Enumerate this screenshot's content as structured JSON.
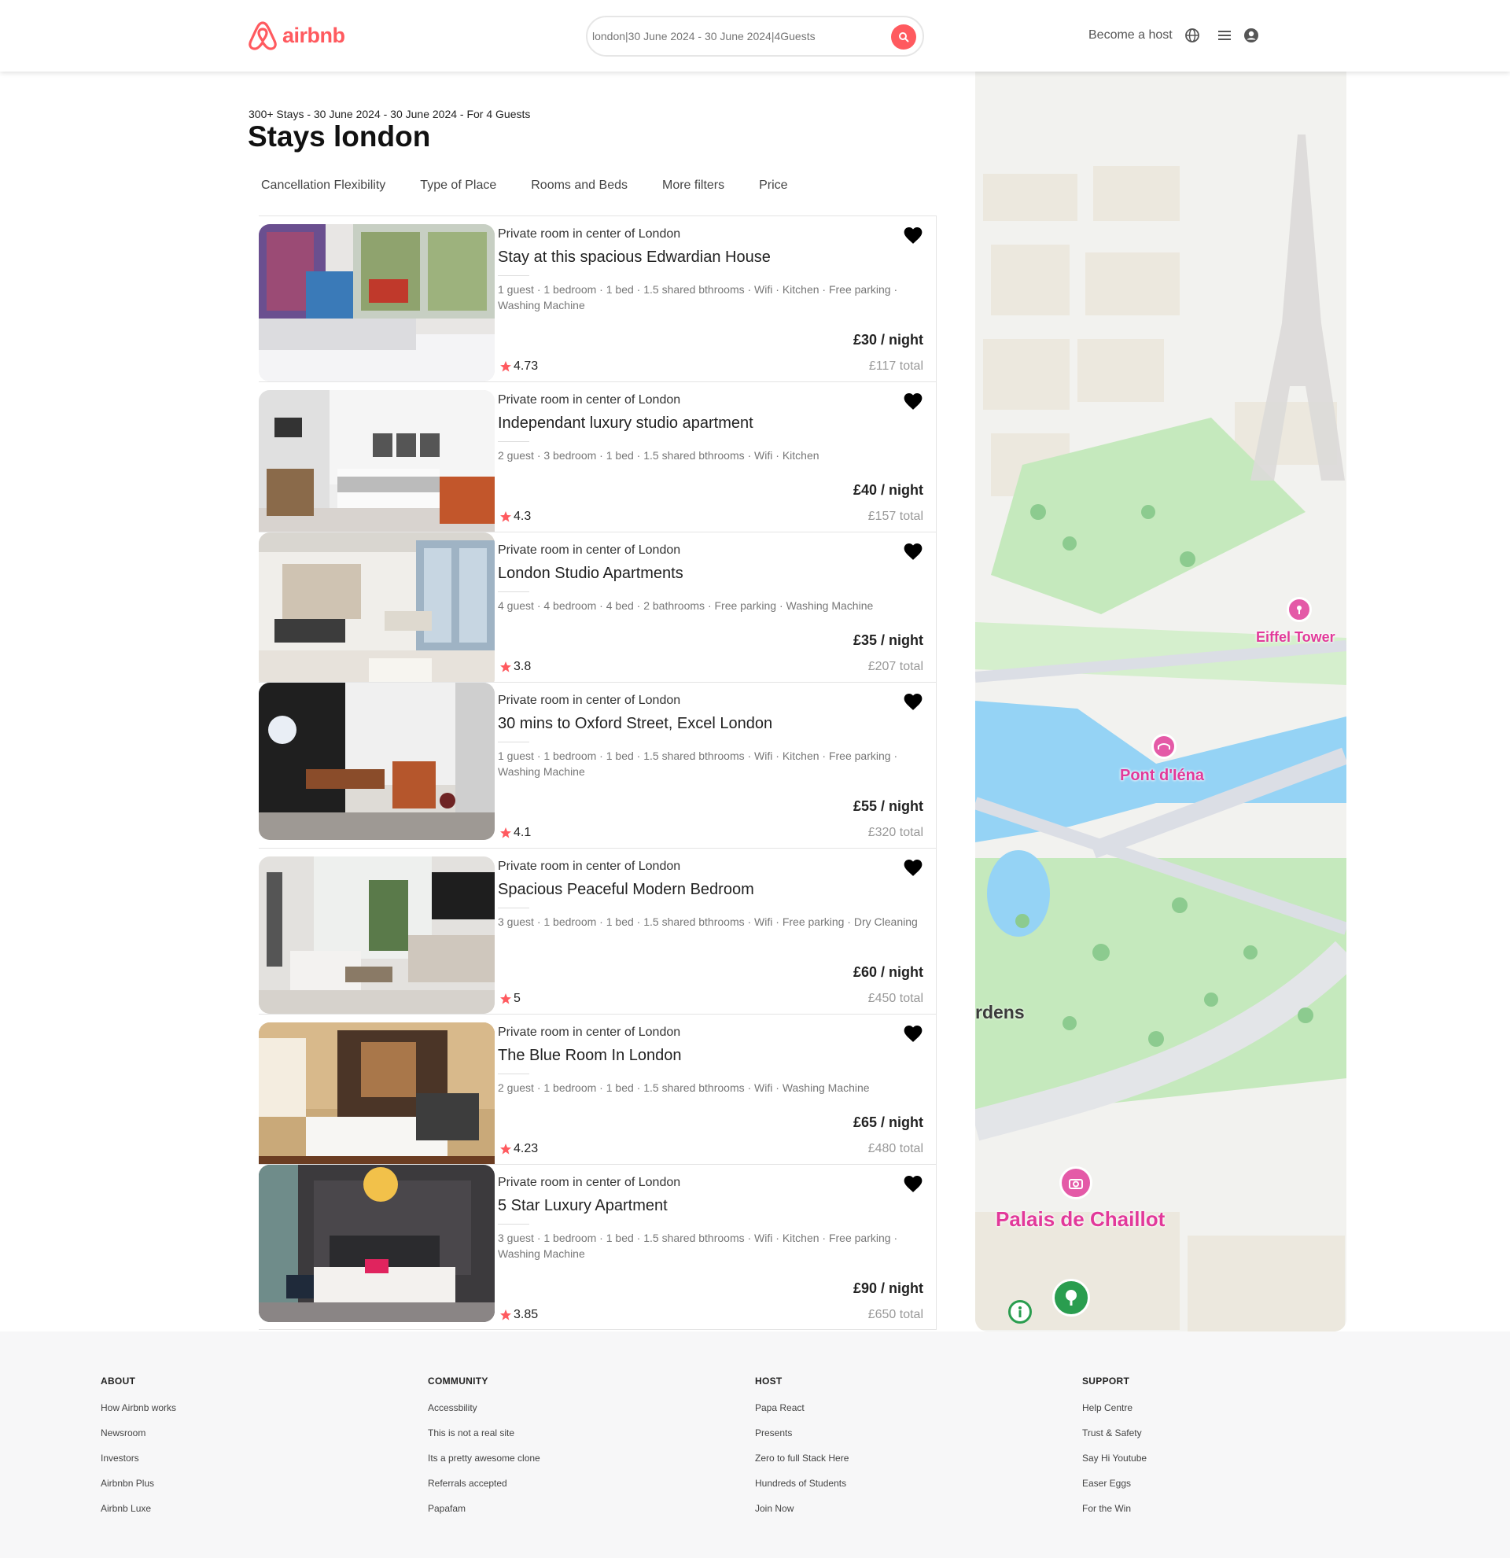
{
  "header": {
    "logo_text": "airbnb",
    "search_placeholder": "london|30 June 2024 - 30 June 2024|4Guests",
    "become_host": "Become a host",
    "brand_color": "#ff5a5f",
    "icons": [
      "globe-icon",
      "menu-icon",
      "user-icon"
    ]
  },
  "main": {
    "results_meta": "300+ Stays - 30 June 2024 - 30 June 2024 - For 4 Guests",
    "title": "Stays london",
    "filters": [
      "Cancellation Flexibility",
      "Type of Place",
      "Rooms and Beds",
      "More filters",
      "Price"
    ]
  },
  "listings": [
    {
      "subtitle": "Private room in center of London",
      "title": "Stay at this spacious Edwardian House",
      "description": "1 guest · 1 bedroom · 1 bed · 1.5 shared bthrooms · Wifi · Kitchen · Free parking · Washing Machine",
      "price": "£30 / night",
      "total": "£117 total",
      "rating": "4.73"
    },
    {
      "subtitle": "Private room in center of London",
      "title": "Independant luxury studio apartment",
      "description": "2 guest · 3 bedroom · 1 bed · 1.5 shared bthrooms · Wifi · Kitchen",
      "price": "£40 / night",
      "total": "£157 total",
      "rating": "4.3"
    },
    {
      "subtitle": "Private room in center of London",
      "title": "London Studio Apartments",
      "description": "4 guest · 4 bedroom · 4 bed · 2 bathrooms · Free parking · Washing Machine",
      "price": "£35 / night",
      "total": "£207 total",
      "rating": "3.8"
    },
    {
      "subtitle": "Private room in center of London",
      "title": "30 mins to Oxford Street, Excel London",
      "description": "1 guest · 1 bedroom · 1 bed · 1.5 shared bthrooms · Wifi · Kitchen · Free parking · Washing Machine",
      "price": "£55 / night",
      "total": "£320 total",
      "rating": "4.1"
    },
    {
      "subtitle": "Private room in center of London",
      "title": "Spacious Peaceful Modern Bedroom",
      "description": "3 guest · 1 bedroom · 1 bed · 1.5 shared bthrooms · Wifi · Free parking · Dry Cleaning",
      "price": "£60 / night",
      "total": "£450 total",
      "rating": "5"
    },
    {
      "subtitle": "Private room in center of London",
      "title": "The Blue Room In London",
      "description": "2 guest · 1 bedroom · 1 bed · 1.5 shared bthrooms · Wifi · Washing Machine",
      "price": "£65 / night",
      "total": "£480 total",
      "rating": "4.23"
    },
    {
      "subtitle": "Private room in center of London",
      "title": "5 Star Luxury Apartment",
      "description": "3 guest · 1 bedroom · 1 bed · 1.5 shared bthrooms · Wifi · Kitchen · Free parking · Washing Machine",
      "price": "£90 / night",
      "total": "£650 total",
      "rating": "3.85"
    }
  ],
  "map": {
    "labels": [
      "Eiffel Tower",
      "Pont d'Iéna",
      "rdens",
      "Palais de Chaillot"
    ]
  },
  "footer": {
    "columns": [
      {
        "heading": "ABOUT",
        "items": [
          "How Airbnb works",
          "Newsroom",
          "Investors",
          "Airbnbn Plus",
          "Airbnb Luxe"
        ]
      },
      {
        "heading": "COMMUNITY",
        "items": [
          "Accessbility",
          "This is not a real site",
          "Its a pretty awesome clone",
          "Referrals accepted",
          "Papafam"
        ]
      },
      {
        "heading": "HOST",
        "items": [
          "Papa React",
          "Presents",
          "Zero to full Stack Here",
          "Hundreds of Students",
          "Join Now"
        ]
      },
      {
        "heading": "SUPPORT",
        "items": [
          "Help Centre",
          "Trust & Safety",
          "Say Hi Youtube",
          "Easer Eggs",
          "For the Win"
        ]
      }
    ]
  }
}
